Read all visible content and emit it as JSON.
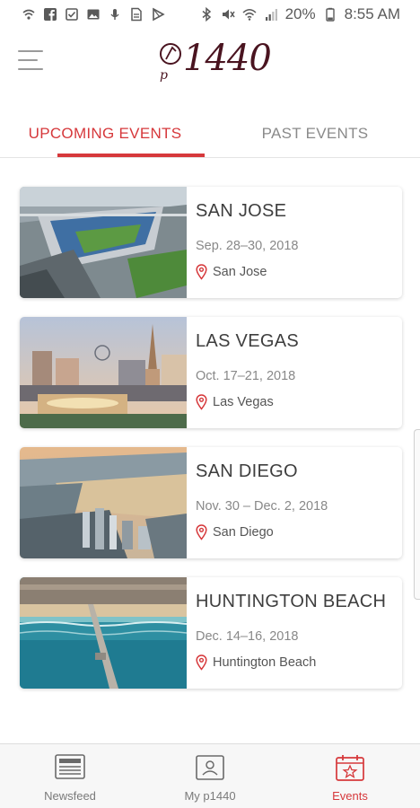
{
  "status_bar": {
    "battery": "20%",
    "time": "8:55 AM",
    "left_icons": [
      "wifi-calling-icon",
      "facebook-icon",
      "checkbox-icon",
      "image-icon",
      "microphone-icon",
      "document-icon",
      "play-store-icon"
    ],
    "right_icons": [
      "bluetooth-icon",
      "mute-icon",
      "wifi-icon",
      "signal-icon",
      "battery-icon"
    ]
  },
  "header": {
    "logo_text": "1440",
    "logo_prefix": "p",
    "menu_icon": "hamburger-menu-icon"
  },
  "tabs": [
    {
      "label": "UPCOMING EVENTS",
      "active": true
    },
    {
      "label": "PAST EVENTS",
      "active": false
    }
  ],
  "events": [
    {
      "city": "SAN JOSE",
      "dates": "Sep. 28–30, 2018",
      "location": "San Jose"
    },
    {
      "city": "LAS VEGAS",
      "dates": "Oct. 17–21, 2018",
      "location": "Las Vegas"
    },
    {
      "city": "SAN DIEGO",
      "dates": "Nov. 30 – Dec. 2, 2018",
      "location": "San Diego"
    },
    {
      "city": "HUNTINGTON BEACH",
      "dates": "Dec. 14–16, 2018",
      "location": "Huntington Beach"
    }
  ],
  "bottom_nav": [
    {
      "label": "Newsfeed",
      "icon": "newsfeed-icon",
      "active": false
    },
    {
      "label": "My p1440",
      "icon": "profile-card-icon",
      "active": false
    },
    {
      "label": "Events",
      "icon": "calendar-star-icon",
      "active": true
    }
  ],
  "colors": {
    "accent": "#d6383b",
    "logo": "#4a1420",
    "inactive_text": "#8a8a8a"
  }
}
